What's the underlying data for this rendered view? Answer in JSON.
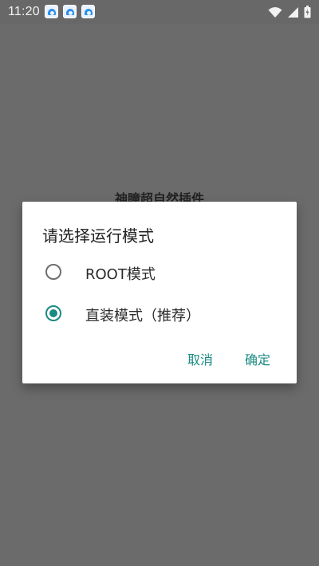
{
  "status_bar": {
    "time": "11:20",
    "notification_icons": [
      "app-notification-icon",
      "app-notification-icon",
      "app-notification-icon"
    ],
    "system_icons": [
      "wifi-icon",
      "signal-icon",
      "battery-icon"
    ]
  },
  "background": {
    "title": "神瞳超自然插件"
  },
  "dialog": {
    "title": "请选择运行模式",
    "options": [
      {
        "label": "ROOT模式",
        "selected": false
      },
      {
        "label": "直装模式（推荐）",
        "selected": true
      }
    ],
    "cancel_label": "取消",
    "confirm_label": "确定"
  },
  "colors": {
    "accent": "#1a8a82",
    "scrim": "#6b6b6b",
    "dialog_bg": "#ffffff"
  }
}
